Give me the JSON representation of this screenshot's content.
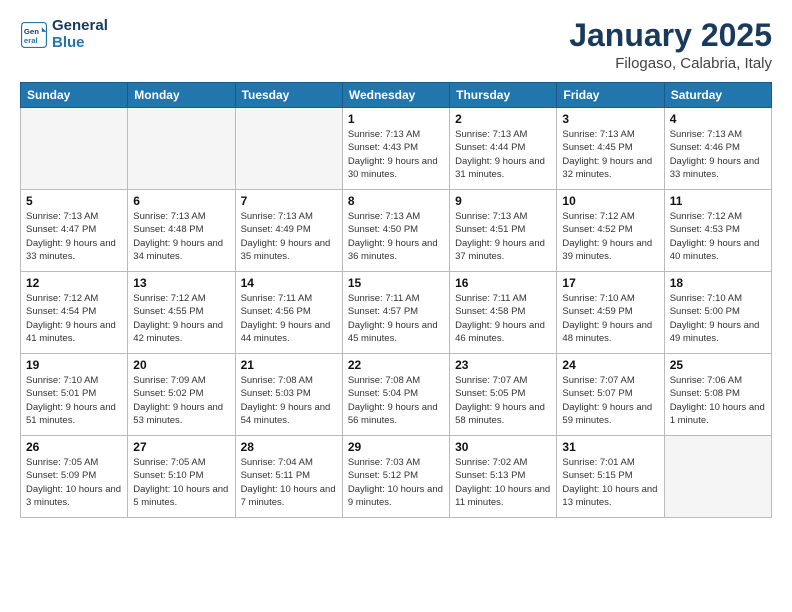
{
  "header": {
    "logo_line1": "General",
    "logo_line2": "Blue",
    "title": "January 2025",
    "subtitle": "Filogaso, Calabria, Italy"
  },
  "days_of_week": [
    "Sunday",
    "Monday",
    "Tuesday",
    "Wednesday",
    "Thursday",
    "Friday",
    "Saturday"
  ],
  "weeks": [
    [
      {
        "day": "",
        "empty": true
      },
      {
        "day": "",
        "empty": true
      },
      {
        "day": "",
        "empty": true
      },
      {
        "day": "1",
        "sunrise": "7:13 AM",
        "sunset": "4:43 PM",
        "daylight": "9 hours and 30 minutes."
      },
      {
        "day": "2",
        "sunrise": "7:13 AM",
        "sunset": "4:44 PM",
        "daylight": "9 hours and 31 minutes."
      },
      {
        "day": "3",
        "sunrise": "7:13 AM",
        "sunset": "4:45 PM",
        "daylight": "9 hours and 32 minutes."
      },
      {
        "day": "4",
        "sunrise": "7:13 AM",
        "sunset": "4:46 PM",
        "daylight": "9 hours and 33 minutes."
      }
    ],
    [
      {
        "day": "5",
        "sunrise": "7:13 AM",
        "sunset": "4:47 PM",
        "daylight": "9 hours and 33 minutes."
      },
      {
        "day": "6",
        "sunrise": "7:13 AM",
        "sunset": "4:48 PM",
        "daylight": "9 hours and 34 minutes."
      },
      {
        "day": "7",
        "sunrise": "7:13 AM",
        "sunset": "4:49 PM",
        "daylight": "9 hours and 35 minutes."
      },
      {
        "day": "8",
        "sunrise": "7:13 AM",
        "sunset": "4:50 PM",
        "daylight": "9 hours and 36 minutes."
      },
      {
        "day": "9",
        "sunrise": "7:13 AM",
        "sunset": "4:51 PM",
        "daylight": "9 hours and 37 minutes."
      },
      {
        "day": "10",
        "sunrise": "7:12 AM",
        "sunset": "4:52 PM",
        "daylight": "9 hours and 39 minutes."
      },
      {
        "day": "11",
        "sunrise": "7:12 AM",
        "sunset": "4:53 PM",
        "daylight": "9 hours and 40 minutes."
      }
    ],
    [
      {
        "day": "12",
        "sunrise": "7:12 AM",
        "sunset": "4:54 PM",
        "daylight": "9 hours and 41 minutes."
      },
      {
        "day": "13",
        "sunrise": "7:12 AM",
        "sunset": "4:55 PM",
        "daylight": "9 hours and 42 minutes."
      },
      {
        "day": "14",
        "sunrise": "7:11 AM",
        "sunset": "4:56 PM",
        "daylight": "9 hours and 44 minutes."
      },
      {
        "day": "15",
        "sunrise": "7:11 AM",
        "sunset": "4:57 PM",
        "daylight": "9 hours and 45 minutes."
      },
      {
        "day": "16",
        "sunrise": "7:11 AM",
        "sunset": "4:58 PM",
        "daylight": "9 hours and 46 minutes."
      },
      {
        "day": "17",
        "sunrise": "7:10 AM",
        "sunset": "4:59 PM",
        "daylight": "9 hours and 48 minutes."
      },
      {
        "day": "18",
        "sunrise": "7:10 AM",
        "sunset": "5:00 PM",
        "daylight": "9 hours and 49 minutes."
      }
    ],
    [
      {
        "day": "19",
        "sunrise": "7:10 AM",
        "sunset": "5:01 PM",
        "daylight": "9 hours and 51 minutes."
      },
      {
        "day": "20",
        "sunrise": "7:09 AM",
        "sunset": "5:02 PM",
        "daylight": "9 hours and 53 minutes."
      },
      {
        "day": "21",
        "sunrise": "7:08 AM",
        "sunset": "5:03 PM",
        "daylight": "9 hours and 54 minutes."
      },
      {
        "day": "22",
        "sunrise": "7:08 AM",
        "sunset": "5:04 PM",
        "daylight": "9 hours and 56 minutes."
      },
      {
        "day": "23",
        "sunrise": "7:07 AM",
        "sunset": "5:05 PM",
        "daylight": "9 hours and 58 minutes."
      },
      {
        "day": "24",
        "sunrise": "7:07 AM",
        "sunset": "5:07 PM",
        "daylight": "9 hours and 59 minutes."
      },
      {
        "day": "25",
        "sunrise": "7:06 AM",
        "sunset": "5:08 PM",
        "daylight": "10 hours and 1 minute."
      }
    ],
    [
      {
        "day": "26",
        "sunrise": "7:05 AM",
        "sunset": "5:09 PM",
        "daylight": "10 hours and 3 minutes."
      },
      {
        "day": "27",
        "sunrise": "7:05 AM",
        "sunset": "5:10 PM",
        "daylight": "10 hours and 5 minutes."
      },
      {
        "day": "28",
        "sunrise": "7:04 AM",
        "sunset": "5:11 PM",
        "daylight": "10 hours and 7 minutes."
      },
      {
        "day": "29",
        "sunrise": "7:03 AM",
        "sunset": "5:12 PM",
        "daylight": "10 hours and 9 minutes."
      },
      {
        "day": "30",
        "sunrise": "7:02 AM",
        "sunset": "5:13 PM",
        "daylight": "10 hours and 11 minutes."
      },
      {
        "day": "31",
        "sunrise": "7:01 AM",
        "sunset": "5:15 PM",
        "daylight": "10 hours and 13 minutes."
      },
      {
        "day": "",
        "empty": true
      }
    ]
  ]
}
